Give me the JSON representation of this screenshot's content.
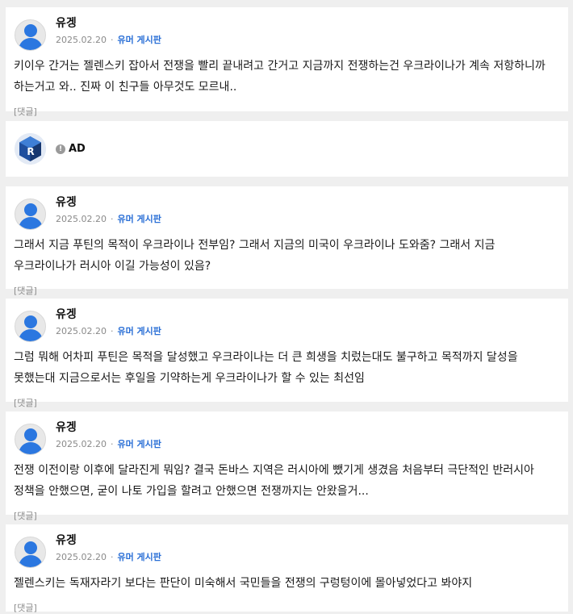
{
  "comments": [
    {
      "author": "유겡",
      "date": "2025.02.20",
      "separator": "·",
      "board": "유머 게시판",
      "text": "키이우 간거는 젤렌스키 잡아서 전쟁을 빨리 끝내려고 간거고 지금까지 전쟁하는건 우크라이나가 계속 저항하니까 하는거고 와.. 진짜 이 친구들 아무것도 모르내..",
      "reply_label": "[댓글]"
    },
    {
      "author": "유겡",
      "date": "2025.02.20",
      "separator": "·",
      "board": "유머 게시판",
      "text": "그래서 지금 푸틴의 목적이 우크라이나 전부임? 그래서 지금의 미국이 우크라이나 도와줌? 그래서 지금 우크라이나가 러시아 이길 가능성이 있음?",
      "reply_label": "[댓글]"
    },
    {
      "author": "유겡",
      "date": "2025.02.20",
      "separator": "·",
      "board": "유머 게시판",
      "text": "그럼 뭐해 어차피 푸틴은 목적을 달성했고 우크라이나는 더 큰 희생을 치렀는대도 불구하고 목적까지 달성을 못했는대 지금으로서는 후일을 기약하는게 우크라이나가 할 수 있는 최선임",
      "reply_label": "[댓글]"
    },
    {
      "author": "유겡",
      "date": "2025.02.20",
      "separator": "·",
      "board": "유머 게시판",
      "text": "전쟁 이전이랑 이후에 달라진게 뭐임? 결국 돈바스 지역은 러시아에 뺐기게 생겼음 처음부터 극단적인 반러시아 정책을 안했으면, 굳이 나토 가입을 할려고 안했으면 전쟁까지는 안왔을거...",
      "reply_label": "[댓글]"
    },
    {
      "author": "유겡",
      "date": "2025.02.20",
      "separator": "·",
      "board": "유머 게시판",
      "text": "젤렌스키는 독재자라기 보다는 판단이 미숙해서 국민들을 전쟁의 구렁텅이에 몰아넣었다고 봐야지",
      "reply_label": "[댓글]"
    }
  ],
  "ad": {
    "info_icon": "!",
    "label": "AD",
    "logo_icon": "r-cube-logo-icon"
  },
  "colors": {
    "avatar_blue": "#2b77e0",
    "board_link": "#2a6fd6",
    "muted": "#8a8a8a",
    "background": "#efefef"
  }
}
